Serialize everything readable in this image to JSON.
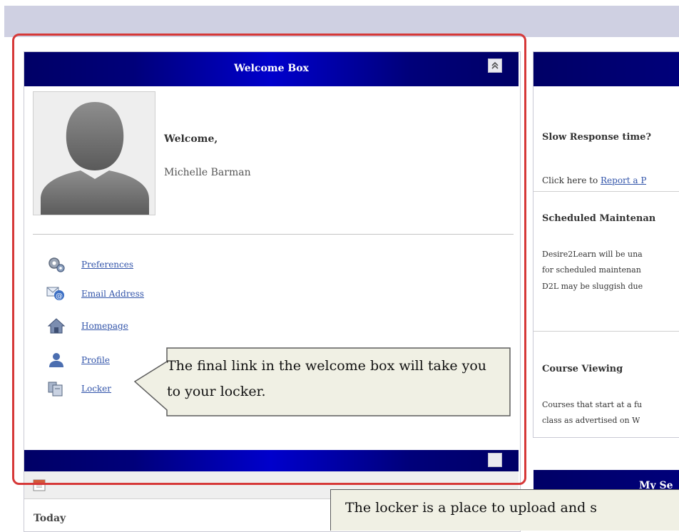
{
  "welcome_box": {
    "title": "Welcome Box",
    "welcome_label": "Welcome,",
    "user_name": "Michelle Barman",
    "links": [
      {
        "label": "Preferences",
        "icon": "preferences-gear-icon"
      },
      {
        "label": "Email Address",
        "icon": "email-at-icon"
      },
      {
        "label": "Homepage",
        "icon": "house-icon"
      },
      {
        "label": "Profile",
        "icon": "person-icon"
      },
      {
        "label": "Locker",
        "icon": "locker-icon"
      }
    ]
  },
  "callouts": {
    "locker_link": "The final link in the welcome box will take you to your locker.",
    "locker_info": "The locker is a place to upload and s"
  },
  "events_widget": {
    "today_label": "Today"
  },
  "news_panel": {
    "item1_title": "Slow Response time?",
    "item1_prefix": "Click here to ",
    "item1_link": "Report a P",
    "item2_title": "Scheduled Maintenan",
    "item2_line1": "Desire2Learn will be una",
    "item2_line2": "for scheduled maintenan",
    "item2_line3": "D2L may be sluggish due",
    "item3_title": "Course Viewing",
    "item3_line1": "Courses that start at a fu",
    "item3_line2": "class as advertised on W"
  },
  "my_settings": {
    "title": "My Se"
  },
  "colors": {
    "header_navy": "#000066",
    "header_bright": "#0000cc",
    "highlight_red": "#d63838",
    "link_blue": "#3355aa",
    "callout_bg": "#f0f0e4"
  }
}
